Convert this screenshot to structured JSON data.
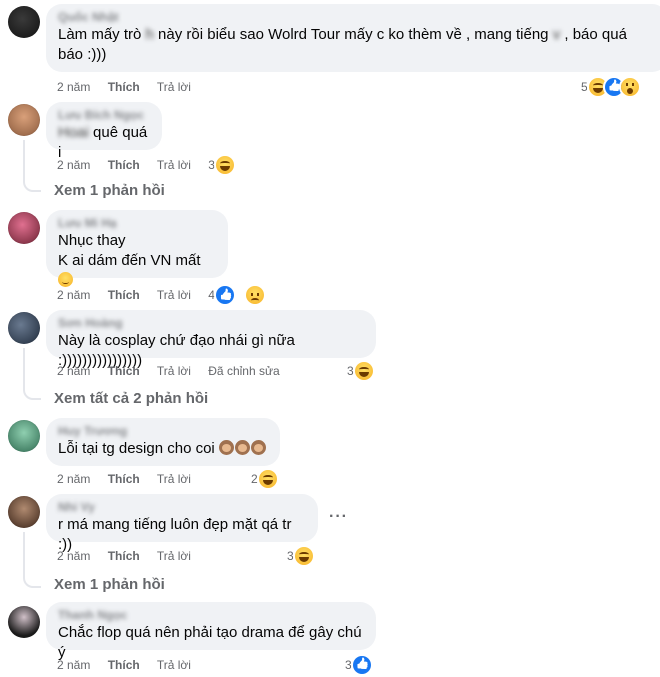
{
  "comments": [
    {
      "name": "Quốc Nhật",
      "text_a": "Làm mấy trò ",
      "blurred_word": "h",
      "text_b": " này rồi biểu sao Wolrd Tour mấy c ko thèm về , mang tiếng ",
      "blurred_word2": "v",
      "text_c": " , báo quá báo :)))",
      "time": "2 năm",
      "like": "Thích",
      "reply": "Trả lời",
      "reaction_count": "5",
      "reactions": [
        "haha-icon",
        "like-icon",
        "wow-icon"
      ]
    },
    {
      "name": "Lưu Bích Ngọc",
      "blurred_prefix": "Hoai",
      "text": " quê quá i",
      "time": "2 năm",
      "like": "Thích",
      "reply": "Trả lời",
      "reaction_count": "3",
      "reactions": [
        "haha-icon"
      ],
      "view_replies": "Xem 1 phản hồi"
    },
    {
      "name": "Lưu Mi Hạ",
      "line1": "Nhục thay",
      "line2": "K ai dám đến VN mất ",
      "emoji": "smile-emoji",
      "time": "2 năm",
      "like": "Thích",
      "reply": "Trả lời",
      "reaction_count": "4",
      "reactions": [
        "like-icon",
        "sad-icon"
      ]
    },
    {
      "name": "Sơn Hoàng",
      "text": "Này là cosplay chứ đạo nhái gì nữa :))))))))))))))))",
      "time": "2 năm",
      "like": "Thích",
      "reply": "Trả lời",
      "edited": "Đã chỉnh sửa",
      "reaction_count": "3",
      "reactions": [
        "haha-icon"
      ],
      "view_replies": "Xem tất cả 2 phản hồi"
    },
    {
      "name": "Huy Trương",
      "text": "Lỗi tại tg design cho coi ",
      "emoji": "see-no-evil-monkey-emoji",
      "time": "2 năm",
      "like": "Thích",
      "reply": "Trả lời",
      "reaction_count": "2",
      "reactions": [
        "haha-icon"
      ]
    },
    {
      "name": "Nhi Vy",
      "text": "r má mang tiếng luôn đẹp mặt qá tr :))",
      "more": "···",
      "time": "2 năm",
      "like": "Thích",
      "reply": "Trả lời",
      "reaction_count": "3",
      "reactions": [
        "haha-icon"
      ],
      "view_replies": "Xem 1 phản hồi"
    },
    {
      "name": "Thanh Ngọc",
      "text": "Chắc flop quá nên phải tạo drama để gây chú ý",
      "time": "2 năm",
      "like": "Thích",
      "reply": "Trả lời",
      "reaction_count": "3",
      "reactions": [
        "like-icon"
      ]
    }
  ],
  "colors": {
    "bubble": "#f0f2f5",
    "secondary_text": "#65676b",
    "like_blue": "#1877f2",
    "haha_yellow": "#f7b125"
  }
}
